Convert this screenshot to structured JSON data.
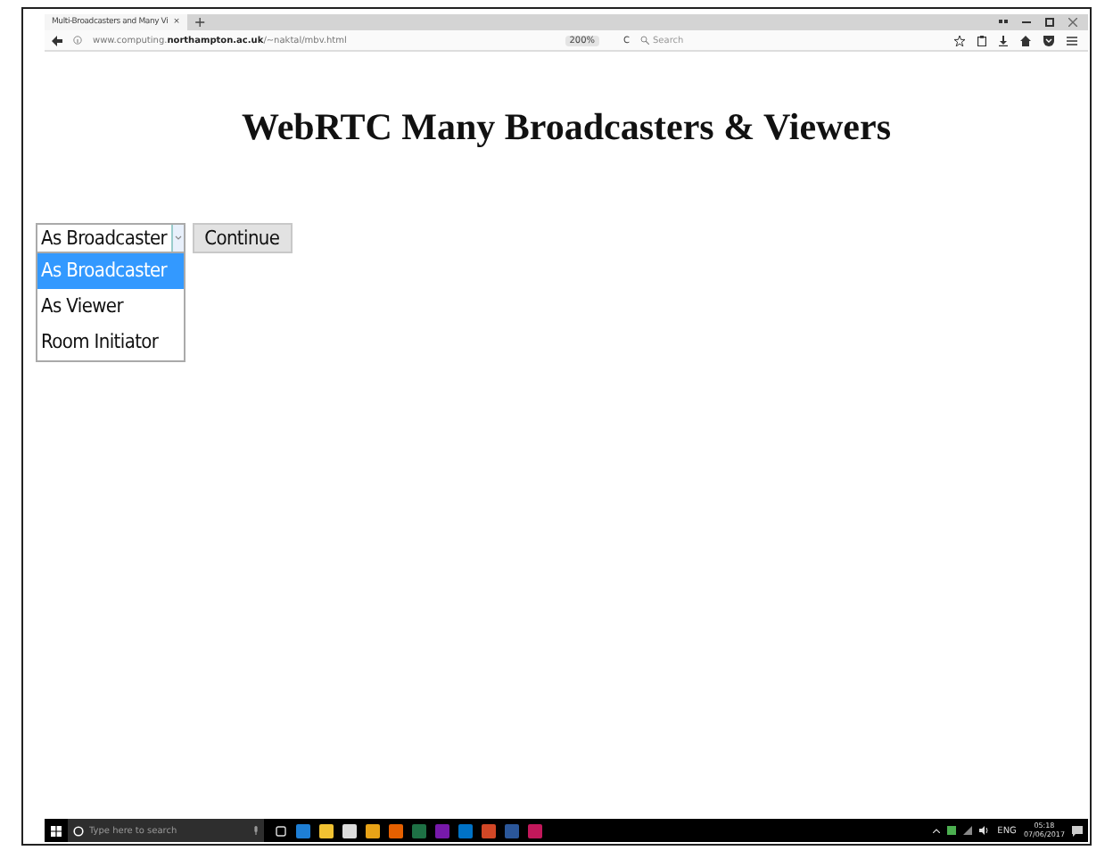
{
  "browser": {
    "tab_title": "Multi-Broadcasters and Many Vi",
    "tab_close": "×",
    "new_tab": "+",
    "url": "www.computing.**northampton.ac.uk**/~naktal/mbv.html",
    "zoom": "200%",
    "reload": "C",
    "search_placeholder": "Search"
  },
  "page": {
    "heading": "WebRTC Many Broadcasters & Viewers",
    "select": {
      "value": "As Broadcaster",
      "expanded": true,
      "options": [
        {
          "label": "As Broadcaster",
          "selected": true
        },
        {
          "label": "As Viewer",
          "selected": false
        },
        {
          "label": "Room Initiator",
          "selected": false
        }
      ]
    },
    "button": "Continue"
  },
  "taskbar": {
    "search_placeholder": "Type here to search",
    "language": "ENG",
    "time": "05:18",
    "date": "07/06/2017"
  }
}
